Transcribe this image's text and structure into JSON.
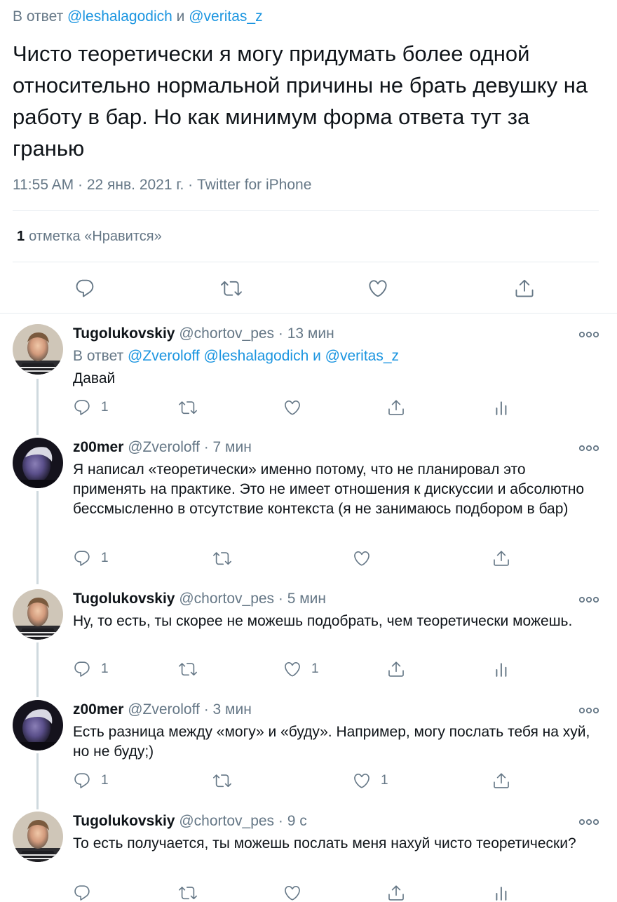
{
  "main_tweet": {
    "reply_prefix": "В ответ",
    "reply_to_1": "@leshalagodich",
    "reply_and": "и",
    "reply_to_2": "@veritas_z",
    "text": "Чисто теоретически я могу придумать более одной относительно нормальной причины не брать девушку на работу в бар. Но как минимум форма ответа тут за гранью",
    "meta": "11:55 AM · 22 янв. 2021 г. · Twitter for iPhone",
    "likes_count": "1",
    "likes_label": "отметка «Нравится»",
    "actions": [
      "reply-icon",
      "retweet-icon",
      "like-icon",
      "share-icon"
    ]
  },
  "replies": [
    {
      "name": "Tugolukovskiy",
      "handle": "@chortov_pes",
      "time": "· 13 мин",
      "reply_prefix": "В ответ",
      "reply_to": "@Zveroloff @leshalagodich и @veritas_z",
      "text": "Давай",
      "reply_count": "1",
      "retweet_count": "",
      "like_count": "",
      "has_analytics": true
    },
    {
      "name": "z00mer",
      "handle": "@Zveroloff",
      "time": "· 7 мин",
      "text": "Я написал «теоретически» именно потому, что не планировал это применять на практике. Это не имеет отношения к дискуссии и абсолютно бессмысленно в отсутствие контекста (я не занимаюсь подбором в бар)",
      "reply_count": "1",
      "retweet_count": "",
      "like_count": "",
      "has_analytics": false
    },
    {
      "name": "Tugolukovskiy",
      "handle": "@chortov_pes",
      "time": "· 5 мин",
      "text": "Ну, то есть, ты скорее не можешь подобрать, чем теоретически можешь.",
      "reply_count": "1",
      "retweet_count": "",
      "like_count": "1",
      "has_analytics": true
    },
    {
      "name": "z00mer",
      "handle": "@Zveroloff",
      "time": "· 3 мин",
      "text": "Есть разница между «могу» и «буду». Например, могу послать тебя на хуй, но не буду;)",
      "reply_count": "1",
      "retweet_count": "",
      "like_count": "1",
      "has_analytics": false
    },
    {
      "name": "Tugolukovskiy",
      "handle": "@chortov_pes",
      "time": "· 9 с",
      "text": "То есть получается, ты можешь послать меня нахуй чисто теоретически?",
      "reply_count": "",
      "retweet_count": "",
      "like_count": "",
      "has_analytics": true
    }
  ],
  "colors": {
    "link": "#1b95e0",
    "secondary_text": "#657786",
    "primary_text": "#0f1419",
    "divider": "#e6ecf0"
  }
}
